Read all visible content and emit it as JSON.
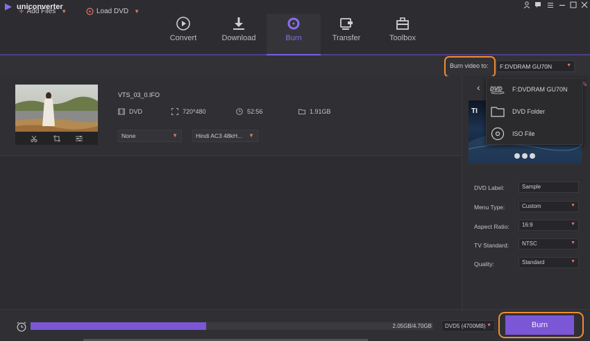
{
  "app": {
    "title": "uniconverter"
  },
  "window_controls": [
    "user-icon",
    "chat-icon",
    "menu-icon",
    "minimize-icon",
    "maximize-icon",
    "close-icon"
  ],
  "nav": {
    "items": [
      {
        "label": "Convert",
        "icon": "convert-icon"
      },
      {
        "label": "Download",
        "icon": "download-icon"
      },
      {
        "label": "Burn",
        "icon": "burn-icon",
        "active": true
      },
      {
        "label": "Transfer",
        "icon": "transfer-icon"
      },
      {
        "label": "Toolbox",
        "icon": "toolbox-icon"
      }
    ]
  },
  "toolbar": {
    "add_files": "Add Files",
    "load_dvd": "Load DVD",
    "burn_to_label": "Burn video to:",
    "burn_to_value": "F:DVDRAM GU70N"
  },
  "file": {
    "name": "VTS_03_0.IFO",
    "format": "DVD",
    "resolution": "720*480",
    "duration": "52:56",
    "size": "1.91GB",
    "subtitle": "None",
    "audio": "Hindi AC3 48kH..."
  },
  "dropdown": {
    "items": [
      {
        "label": "F:DVDRAM GU70N",
        "icon": "dvd-icon"
      },
      {
        "label": "DVD Folder",
        "icon": "folder-icon"
      },
      {
        "label": "ISO File",
        "icon": "disc-icon"
      }
    ]
  },
  "settings": {
    "dvd_label": {
      "label": "DVD Label:",
      "value": "Sample"
    },
    "menu_type": {
      "label": "Menu Type:",
      "value": "Custom"
    },
    "aspect_ratio": {
      "label": "Aspect Ratio:",
      "value": "16:9"
    },
    "tv_standard": {
      "label": "TV Standard:",
      "value": "NTSC"
    },
    "quality": {
      "label": "Quality:",
      "value": "Standard"
    }
  },
  "bottom": {
    "progress_text": "2.05GB/4.70GB",
    "progress_fraction": 0.436,
    "disc_type": "DVD5 (4700MB)",
    "burn_label": "Burn"
  },
  "colors": {
    "accent": "#7b56d6",
    "highlight": "#ef8c34",
    "caret": "#e0776b"
  }
}
